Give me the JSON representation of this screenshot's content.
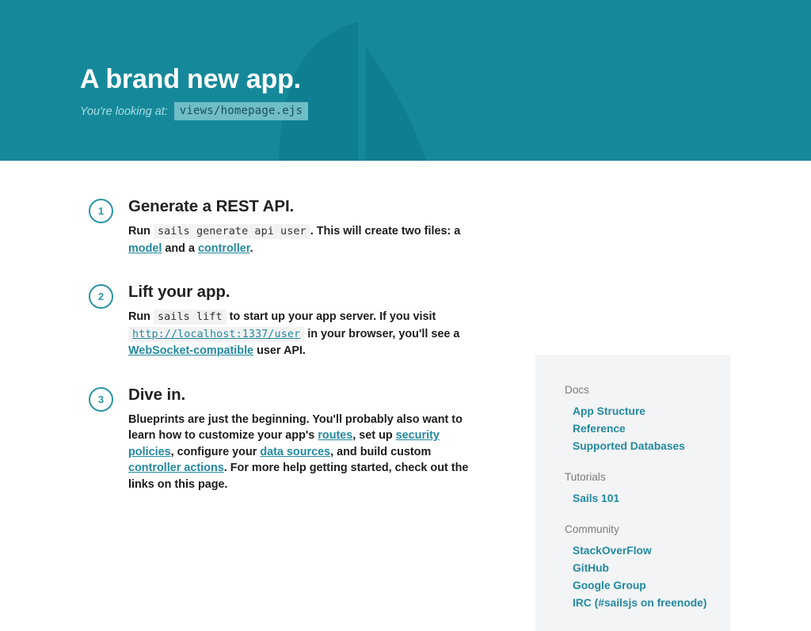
{
  "hero": {
    "title": "A brand new app.",
    "subtitle_label": "You're looking at:",
    "file_chip": "views/homepage.ejs",
    "background_color": "#15899a",
    "art": "sailboat-watermark"
  },
  "steps": [
    {
      "number": "1",
      "title": "Generate a REST API.",
      "body_parts": {
        "run_word": "Run",
        "command": "sails generate api user",
        "after_command": ". This will create two files: a ",
        "link1": "model",
        "between_links": " and a ",
        "link2": "controller",
        "tail": "."
      }
    },
    {
      "number": "2",
      "title": "Lift your app.",
      "body_parts": {
        "run_word": "Run",
        "command": "sails lift",
        "after_command": " to start up your app server. If you visit ",
        "url": "http://localhost:1337/user",
        "after_url": " in your browser, you'll see a ",
        "link1": "WebSocket-compatible",
        "tail": " user API."
      }
    },
    {
      "number": "3",
      "title": "Dive in.",
      "body_parts": {
        "intro": "Blueprints are just the beginning. You'll probably also want to learn how to customize your app's ",
        "link1": "routes",
        "mid1": ", set up ",
        "link2": "security policies",
        "mid2": ", configure your ",
        "link3": "data sources",
        "mid3": ", and build custom ",
        "link4": "controller actions",
        "tail": ". For more help getting started, check out the links on this page."
      }
    }
  ],
  "panel": {
    "groups": [
      {
        "heading": "Docs",
        "links": [
          "App Structure",
          "Reference",
          "Supported Databases"
        ]
      },
      {
        "heading": "Tutorials",
        "links": [
          "Sails 101"
        ]
      },
      {
        "heading": "Community",
        "links": [
          "StackOverFlow",
          "GitHub",
          "Google Group",
          "IRC (#sailsjs on freenode)"
        ]
      }
    ]
  },
  "colors": {
    "brand_teal": "#15899a",
    "link_teal": "#2389a0",
    "badge_teal": "#2b95a6",
    "panel_bg": "#f3f4f5",
    "heading_gray": "#7b7b7b",
    "code_bg": "#f2f2f2",
    "chip_bg": "#6fbdc6"
  }
}
